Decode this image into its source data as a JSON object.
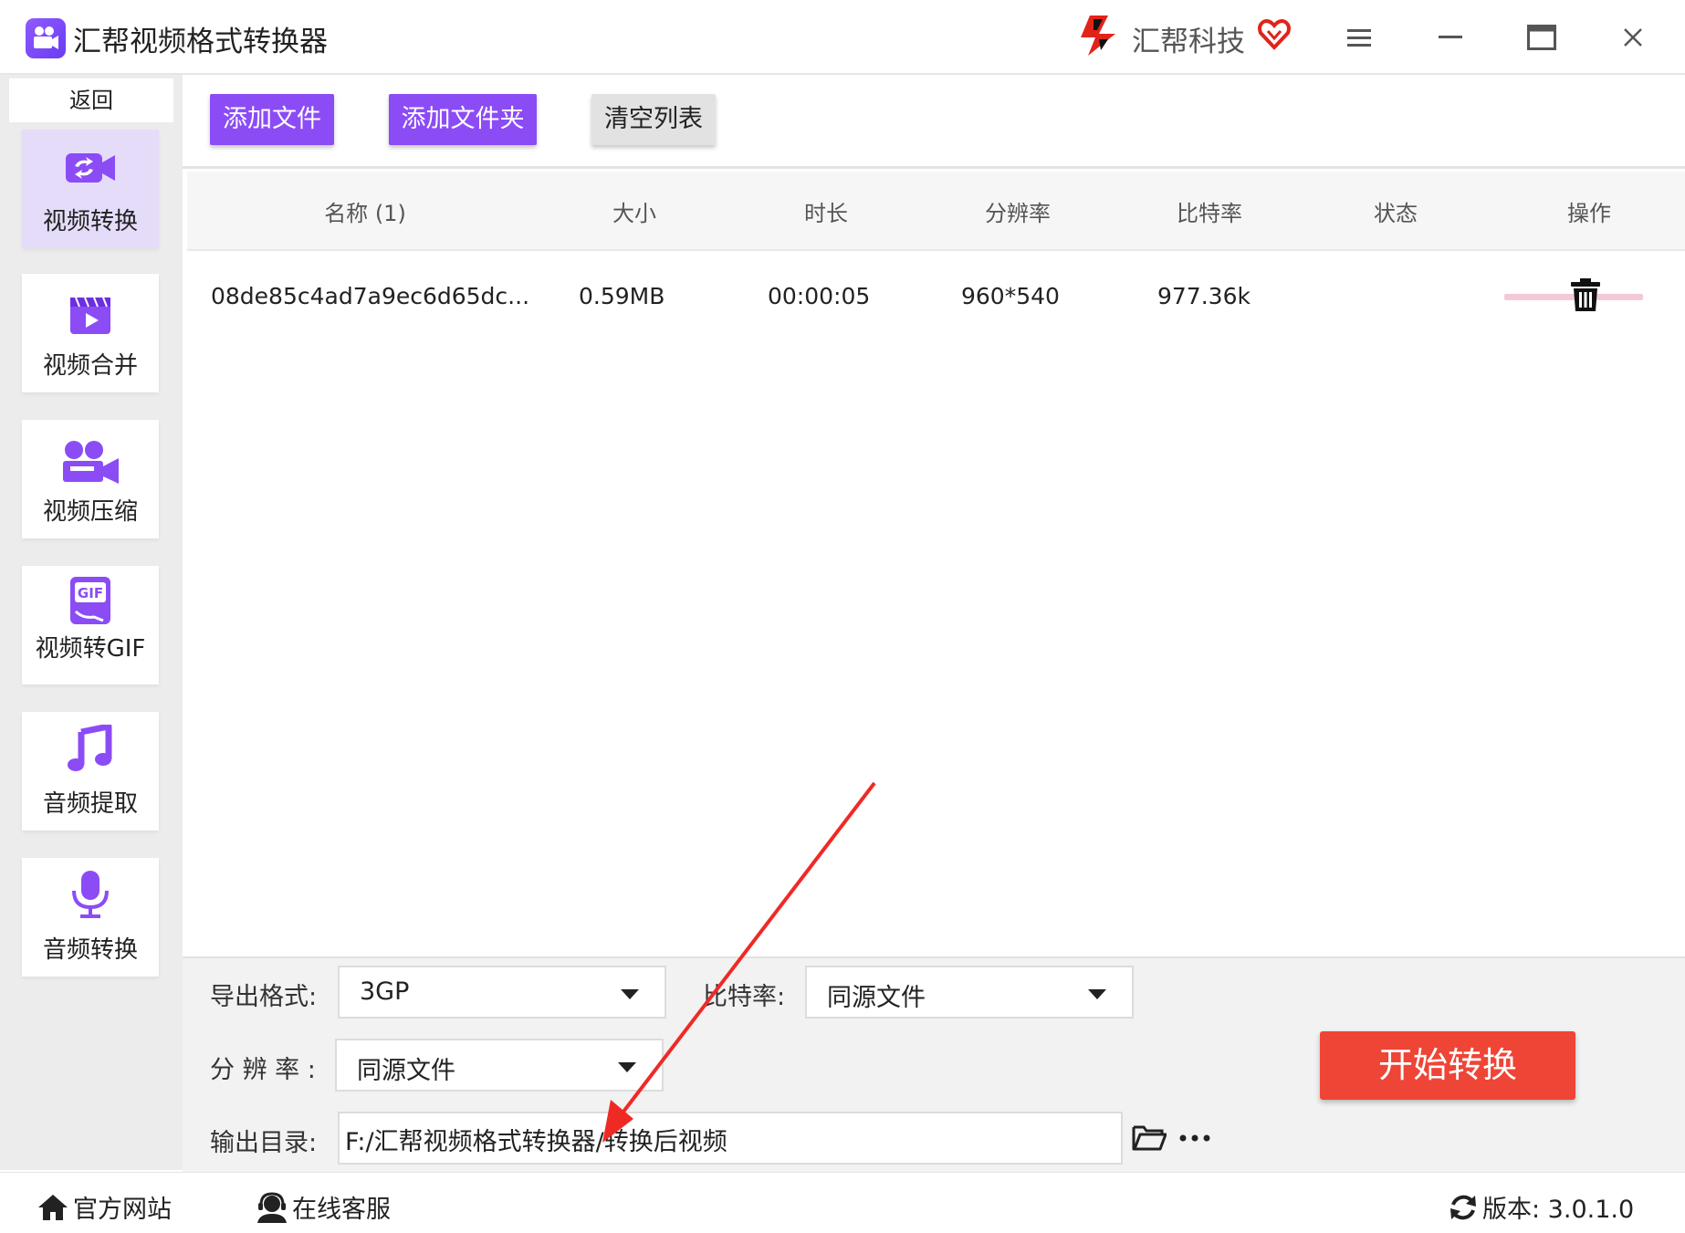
{
  "window": {
    "title": "汇帮视频格式转换器",
    "brand": "汇帮科技"
  },
  "sidebar": {
    "back_label": "返回",
    "items": [
      {
        "label": "视频转换",
        "icon": "video-convert-icon",
        "active": true
      },
      {
        "label": "视频合并",
        "icon": "video-merge-icon",
        "active": false
      },
      {
        "label": "视频压缩",
        "icon": "video-compress-icon",
        "active": false
      },
      {
        "label": "视频转GIF",
        "icon": "gif-icon",
        "active": false
      },
      {
        "label": "音频提取",
        "icon": "music-note-icon",
        "active": false
      },
      {
        "label": "音频转换",
        "icon": "microphone-icon",
        "active": false
      }
    ]
  },
  "toolbar": {
    "add_file": "添加文件",
    "add_folder": "添加文件夹",
    "clear_list": "清空列表"
  },
  "table": {
    "columns": [
      "名称 (1)",
      "大小",
      "时长",
      "分辨率",
      "比特率",
      "状态",
      "操作"
    ],
    "rows": [
      {
        "name": "08de85c4ad7a9ec6d65dc...",
        "size": "0.59MB",
        "duration": "00:00:05",
        "resolution": "960*540",
        "bitrate": "977.36k",
        "status_icon": "progress-bar",
        "action_icon": "trash-icon"
      }
    ]
  },
  "settings": {
    "format_label": "导出格式:",
    "format_value": "3GP",
    "bitrate_label": "比特率:",
    "bitrate_value": "同源文件",
    "resolution_label": "分 辨 率 :",
    "resolution_value": "同源文件",
    "output_label": "输出目录:",
    "output_path": "F:/汇帮视频格式转换器/转换后视频",
    "start_button": "开始转换"
  },
  "footer": {
    "website": "官方网站",
    "support": "在线客服",
    "version": "版本:  3.0.1.0"
  },
  "colors": {
    "accent_purple": "#8b4cf6",
    "start_red": "#ef4536",
    "active_sidebar": "#e5dcfa",
    "annotation_arrow": "#ef2a25"
  }
}
